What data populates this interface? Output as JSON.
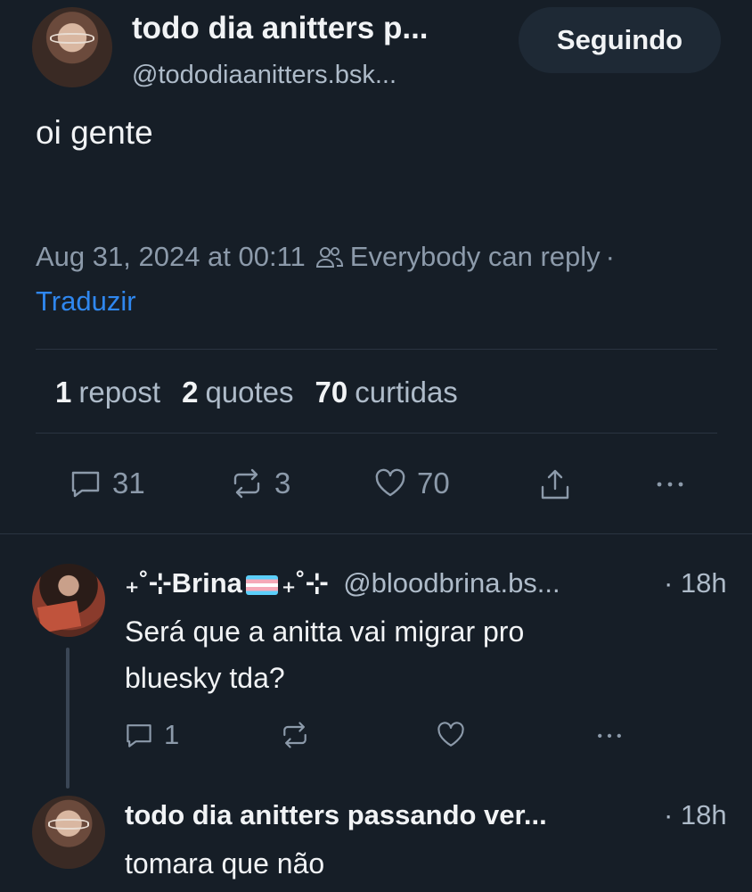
{
  "post": {
    "author_name": "todo dia anitters p...",
    "author_handle": "@tododiaanitters.bsk...",
    "follow_label": "Seguindo",
    "text": "oi gente",
    "timestamp": "Aug 31, 2024 at 00:11",
    "reply_setting": "Everybody can reply",
    "separator": "·",
    "translate_label": "Traduzir",
    "stats": {
      "reposts_count": "1",
      "reposts_label": "repost",
      "quotes_count": "2",
      "quotes_label": "quotes",
      "likes_count": "70",
      "likes_label": "curtidas"
    },
    "actions": {
      "reply_count": "31",
      "repost_count": "3",
      "like_count": "70"
    }
  },
  "replies": [
    {
      "name_prefix": "₊˚⊹Brina",
      "name_suffix": "₊˚⊹",
      "handle": "@bloodbrina.bs...",
      "time": "· 18h",
      "text_line1": "Será que a anitta vai migrar pro",
      "text_line2": "bluesky tda?",
      "reply_count": "1"
    },
    {
      "name": "todo dia anitters passando ver...",
      "time": "· 18h",
      "text": "tomara que não"
    }
  ],
  "icons": {
    "people": "people-icon",
    "reply": "speech-bubble-icon",
    "repost": "repost-arrows-icon",
    "like": "heart-icon",
    "share": "share-upload-icon",
    "more": "ellipsis-icon"
  },
  "colors": {
    "background": "#161e27",
    "link": "#2f87ef",
    "muted": "#8c9aaa"
  }
}
